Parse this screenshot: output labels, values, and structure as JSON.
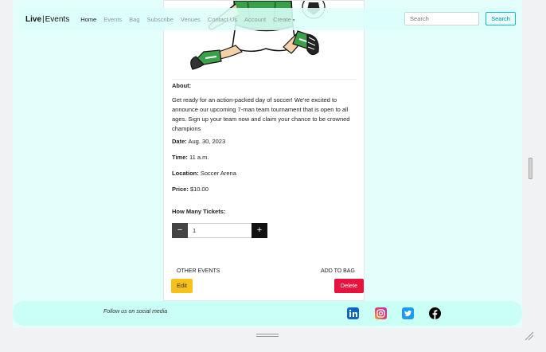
{
  "navbar": {
    "brand_left": "Live",
    "brand_sep": "|",
    "brand_right": "Events",
    "links": [
      "Home",
      "Events",
      "Bag",
      "Subscribe",
      "Venues",
      "Contact Us",
      "Account",
      "Create"
    ],
    "search_placeholder": "Search",
    "search_button": "Search"
  },
  "event": {
    "about_label": "About:",
    "about_text": "Get ready for an action-packed day of soccer! We're excited to announce our upcoming 7-man team tournament that is open to all ages. Sign up your team now and claim your chance to be crowned champions",
    "date_label": "Date:",
    "date_value": "Aug. 30, 2023",
    "time_label": "Time:",
    "time_value": "11 a.m.",
    "location_label": "Location:",
    "location_value": "Soccer Arena",
    "price_label": "Price:",
    "price_value": "$10.00",
    "tickets_label": "How Many Tickets:",
    "quantity": "1",
    "minus": "−",
    "plus": "+",
    "other_events": "OTHER EVENTS",
    "add_to_bag": "ADD TO BAG",
    "edit": "Edit",
    "delete": "Delete"
  },
  "footer": {
    "follow_text": "Follow us on social media",
    "icons": [
      "linkedin-icon",
      "instagram-icon",
      "twitter-icon",
      "facebook-icon"
    ]
  },
  "colors": {
    "page_bg": "#e4fffb",
    "footer_bg": "#c9fff5",
    "edit": "#f6c21a",
    "delete": "#e7123e",
    "search_accent": "#19b8c9"
  }
}
